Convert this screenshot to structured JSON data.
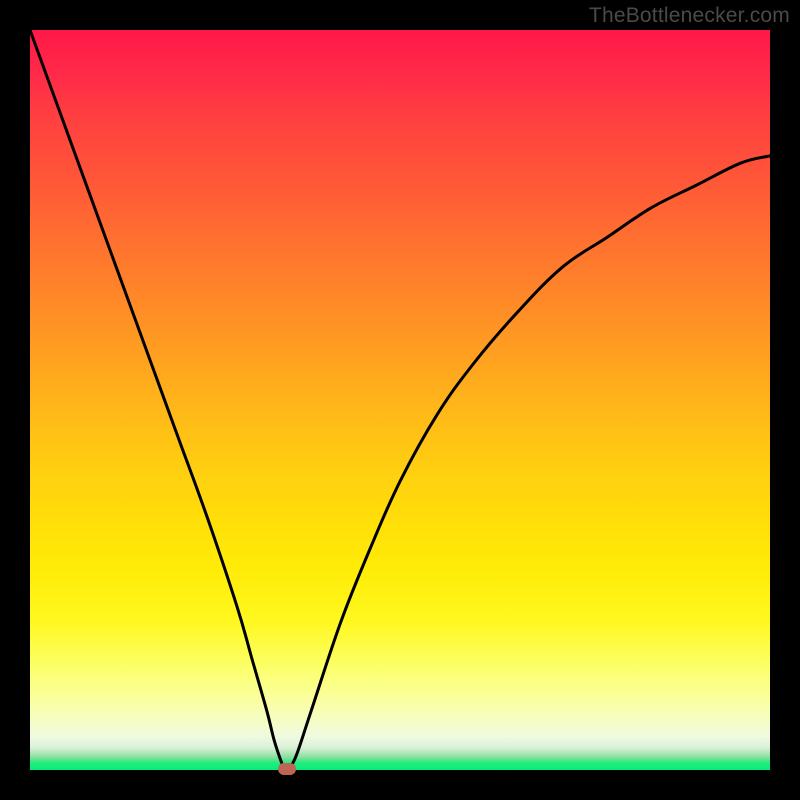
{
  "attribution": "TheBottlenecker.com",
  "chart_data": {
    "type": "line",
    "title": "",
    "xlabel": "",
    "ylabel": "",
    "xlim": [
      0,
      100
    ],
    "ylim": [
      0,
      100
    ],
    "series": [
      {
        "name": "bottleneck-curve",
        "x": [
          0,
          4,
          8,
          12,
          16,
          20,
          24,
          28,
          30,
          32,
          33,
          34,
          34.5,
          35,
          36,
          38,
          42,
          46,
          50,
          55,
          60,
          66,
          72,
          78,
          84,
          90,
          96,
          100
        ],
        "values": [
          100,
          89,
          78,
          67,
          56,
          45,
          34,
          22,
          15,
          8,
          4,
          1,
          0,
          0.2,
          2,
          8,
          20,
          30,
          39,
          48,
          55,
          62,
          68,
          72,
          76,
          79,
          82,
          83
        ]
      }
    ],
    "marker": {
      "x": 34.7,
      "y": 0.1
    },
    "background_gradient_stops": [
      {
        "pct": 0,
        "color": "#ff1848"
      },
      {
        "pct": 50,
        "color": "#ffba18"
      },
      {
        "pct": 85,
        "color": "#fcff68"
      },
      {
        "pct": 100,
        "color": "#00ef78"
      }
    ]
  }
}
